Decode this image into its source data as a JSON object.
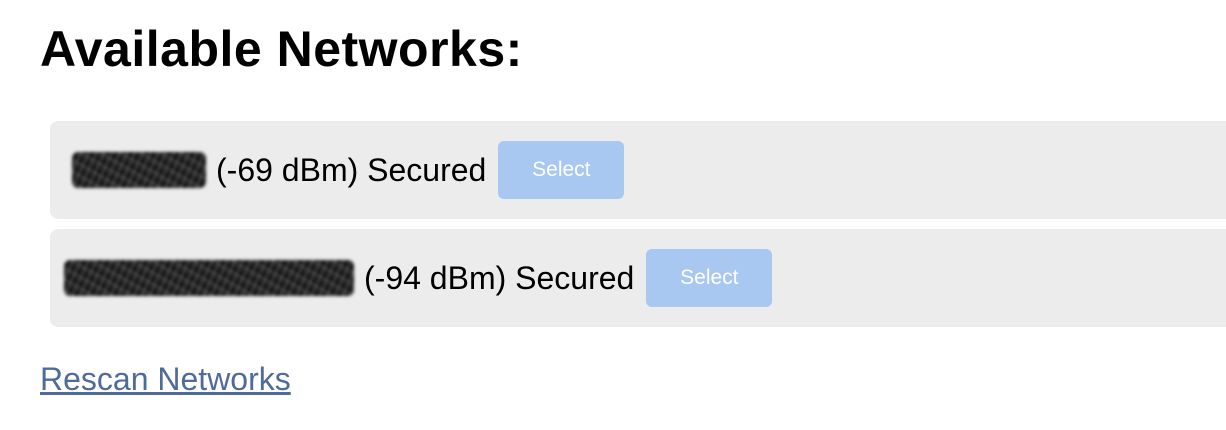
{
  "page": {
    "title": "Available Networks:"
  },
  "networks": [
    {
      "signal": "(-69 dBm)",
      "security": "Secured",
      "select_label": "Select"
    },
    {
      "signal": "(-94 dBm)",
      "security": "Secured",
      "select_label": "Select"
    }
  ],
  "rescan_label": "Rescan Networks",
  "colors": {
    "row_background": "#ececec",
    "select_button": "#a8c7f1",
    "link": "#4f6b99"
  }
}
